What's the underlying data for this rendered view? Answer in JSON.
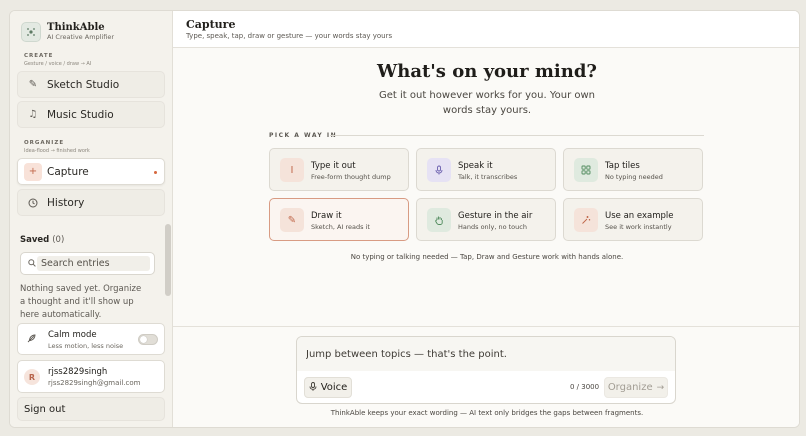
{
  "brand": {
    "name": "ThinkAble",
    "subtitle": "AI Creative Amplifier"
  },
  "sidebar": {
    "create": {
      "heading": "CREATE",
      "sub": "Gesture / voice / draw → AI"
    },
    "create_items": [
      {
        "label": "Sketch Studio",
        "icon": "pencil-icon"
      },
      {
        "label": "Music Studio",
        "icon": "music-note-icon"
      }
    ],
    "organize": {
      "heading": "ORGANIZE",
      "sub": "Idea-flood → finished work"
    },
    "organize_items": [
      {
        "label": "Capture",
        "icon": "plus-icon",
        "active": true
      },
      {
        "label": "History",
        "icon": "clock-icon"
      }
    ],
    "saved": {
      "label": "Saved",
      "count": "(0)",
      "search_placeholder": "Search entries",
      "empty_text": "Nothing saved yet. Organize a thought and it'll show up here automatically."
    },
    "calm_mode": {
      "title": "Calm mode",
      "sub": "Less motion, less noise",
      "enabled": false
    },
    "user": {
      "initial": "R",
      "name": "rjss2829singh",
      "email": "rjss2829singh@gmail.com"
    },
    "signout_label": "Sign out"
  },
  "header": {
    "title": "Capture",
    "subtitle": "Type, speak, tap, draw or gesture — your words stay yours"
  },
  "hero": {
    "title": "What's on your mind?",
    "subtitle": "Get it out however works for you. Your own words stay yours."
  },
  "pick_label": "PICK A WAY IN",
  "modes": [
    {
      "title": "Type it out",
      "sub": "Free-form thought dump",
      "icon": "text-cursor-icon",
      "color": "#c0674a",
      "bg": "#f5e3da"
    },
    {
      "title": "Speak it",
      "sub": "Talk, it transcribes",
      "icon": "microphone-icon",
      "color": "#6b5fae",
      "bg": "#e6e2f4"
    },
    {
      "title": "Tap tiles",
      "sub": "No typing needed",
      "icon": "grid-icon",
      "color": "#4f8a5c",
      "bg": "#dfeadf"
    },
    {
      "title": "Draw it",
      "sub": "Sketch, AI reads it",
      "icon": "pencil-icon",
      "color": "#c0674a",
      "bg": "#f5e3da",
      "selected": true
    },
    {
      "title": "Gesture in the air",
      "sub": "Hands only, no touch",
      "icon": "hand-icon",
      "color": "#4f8a5c",
      "bg": "#dfeadf"
    },
    {
      "title": "Use an example",
      "sub": "See it work instantly",
      "icon": "wand-icon",
      "color": "#c0674a",
      "bg": "#f5e3da"
    }
  ],
  "note": "No typing or talking needed — Tap, Draw and Gesture work with hands alone.",
  "composer": {
    "placeholder": "Jump between topics — that's the point.",
    "voice_label": "Voice",
    "counter": "0 / 3000",
    "organize_label": "Organize"
  },
  "footer_note": "ThinkAble keeps your exact wording — AI text only bridges the gaps between fragments."
}
